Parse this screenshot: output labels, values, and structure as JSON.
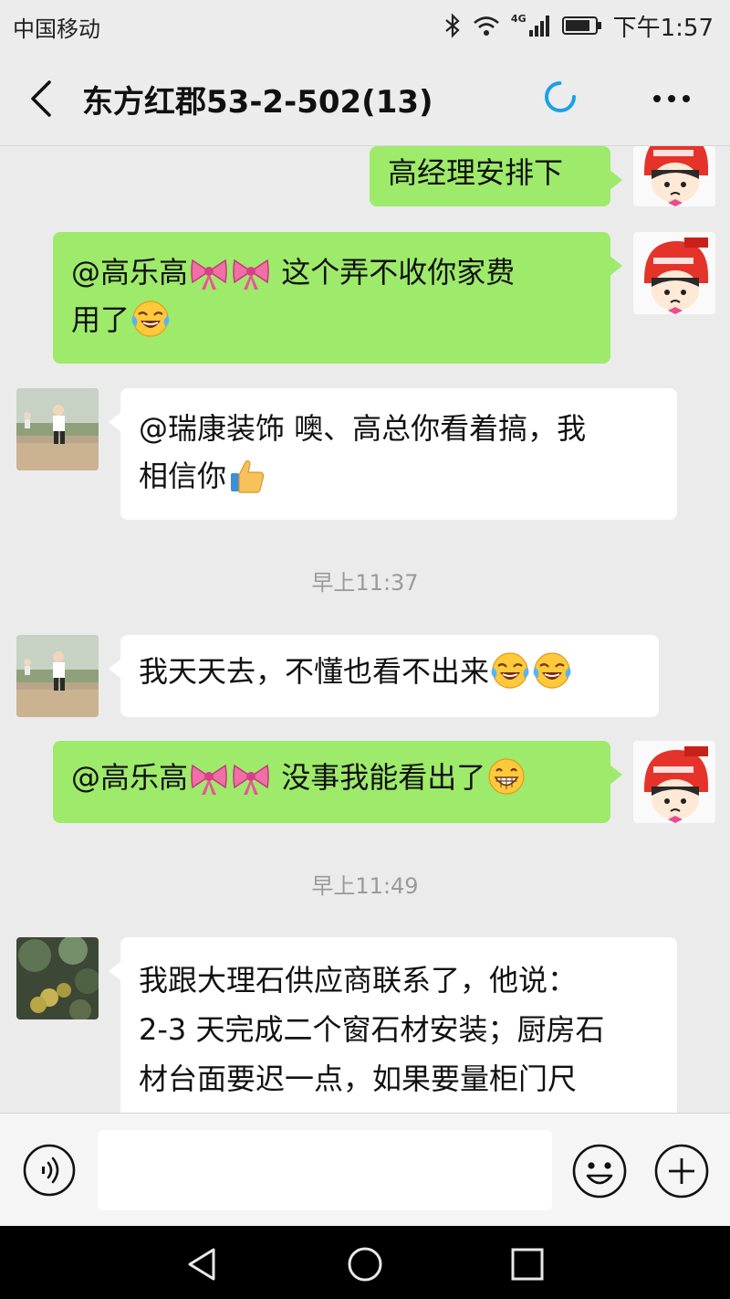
{
  "status_bar": {
    "carrier": "中国移动",
    "network": "4G",
    "time": "下午1:57",
    "icons": [
      "bluetooth-icon",
      "wifi-icon",
      "signal-icon",
      "battery-icon"
    ]
  },
  "header": {
    "title": "东方红郡53-2-502(13)",
    "icons": [
      "back-icon",
      "loading-icon",
      "more-icon"
    ]
  },
  "chat": {
    "m1_text": "高经理安排下",
    "m2_line1a": "@高乐高",
    "m2_line1b": " 这个弄不收你家费",
    "m2_line2": "用了",
    "m3_line1": "@瑞康装饰  噢、高总你看着搞，我",
    "m3_line2": "相信你",
    "time1": "早上11:37",
    "m4_text": "我天天去，不懂也看不出来",
    "m5_a": "@高乐高",
    "m5_b": " 没事我能看出了",
    "time2": "早上11:49",
    "m6_line1": "我跟大理石供应商联系了，他说：",
    "m6_line2": "2-3 天完成二个窗石材安装；厨房石",
    "m6_line3": "材台面要迟一点，如果要量柜门尺"
  },
  "emoji_names": [
    "bow-emoji",
    "tears-of-joy-emoji",
    "thumbs-up-emoji",
    "grinning-emoji"
  ],
  "input_bar": {
    "value": "",
    "icons": [
      "voice-icon",
      "emoji-icon",
      "plus-icon"
    ]
  },
  "system_nav": {
    "icons": [
      "back-triangle-icon",
      "home-circle-icon",
      "recents-square-icon"
    ]
  },
  "colors": {
    "own_bubble": "#9eea6a",
    "other_bubble": "#ffffff",
    "background": "#ebebeb",
    "loader_accent": "#1aa0e8"
  }
}
